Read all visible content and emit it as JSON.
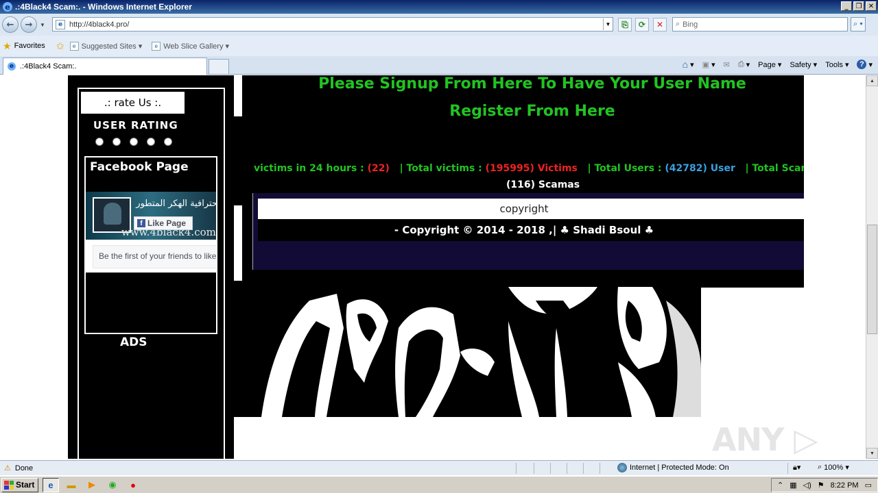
{
  "window": {
    "title": ".:4Black4 Scam:. - Windows Internet Explorer",
    "minimize": "_",
    "restore": "❐",
    "close": "✕"
  },
  "nav": {
    "back": "←",
    "forward": "→",
    "url": "http://4black4.pro/",
    "search_placeholder": "Bing"
  },
  "favorites": {
    "favorites_label": "Favorites",
    "suggested_sites": "Suggested Sites ▾",
    "web_slice_gallery": "Web Slice Gallery ▾"
  },
  "tabs": [
    {
      "label": ".:4Black4 Scam:."
    }
  ],
  "command_bar": {
    "page": "Page ▾",
    "safety": "Safety ▾",
    "tools": "Tools ▾",
    "help": "?"
  },
  "page": {
    "rate_us": ".: rate Us :.",
    "user_rating": "USER RATING",
    "facebook_page": "Facebook Page",
    "fb_banner_arabic": "حترافية الهكر المتطور",
    "fb_banner_site": "www.4black4.com",
    "fb_like": "Like Page",
    "fb_friends": "Be the first of your friends to like this",
    "ads": "ADS",
    "signup": "Please Signup From Here To Have Your User Name",
    "register": "Register From Here",
    "stats": {
      "victims_24h_label": "victims in 24 hours : ",
      "victims_24h_value": "(22)",
      "total_victims_label": "|  Total victims : ",
      "total_victims_value": "(195995) Victims",
      "total_users_label": "|  Total Users : ",
      "total_users_value": "(42782) User",
      "total_scamas_label": "|  Total Scamas : ",
      "scamas_line": "(116) Scamas"
    },
    "copyright_label": "copyright",
    "copyright_text": "- Copyright © 2014 - 2018 ,| ♣ Shadi Bsoul ♣"
  },
  "watermark": "ANY ▷ RUN",
  "status": {
    "text": "Done",
    "zone": "Internet | Protected Mode: On",
    "zoom": "100%"
  },
  "taskbar": {
    "start": "Start",
    "clock": "8:22 PM"
  }
}
